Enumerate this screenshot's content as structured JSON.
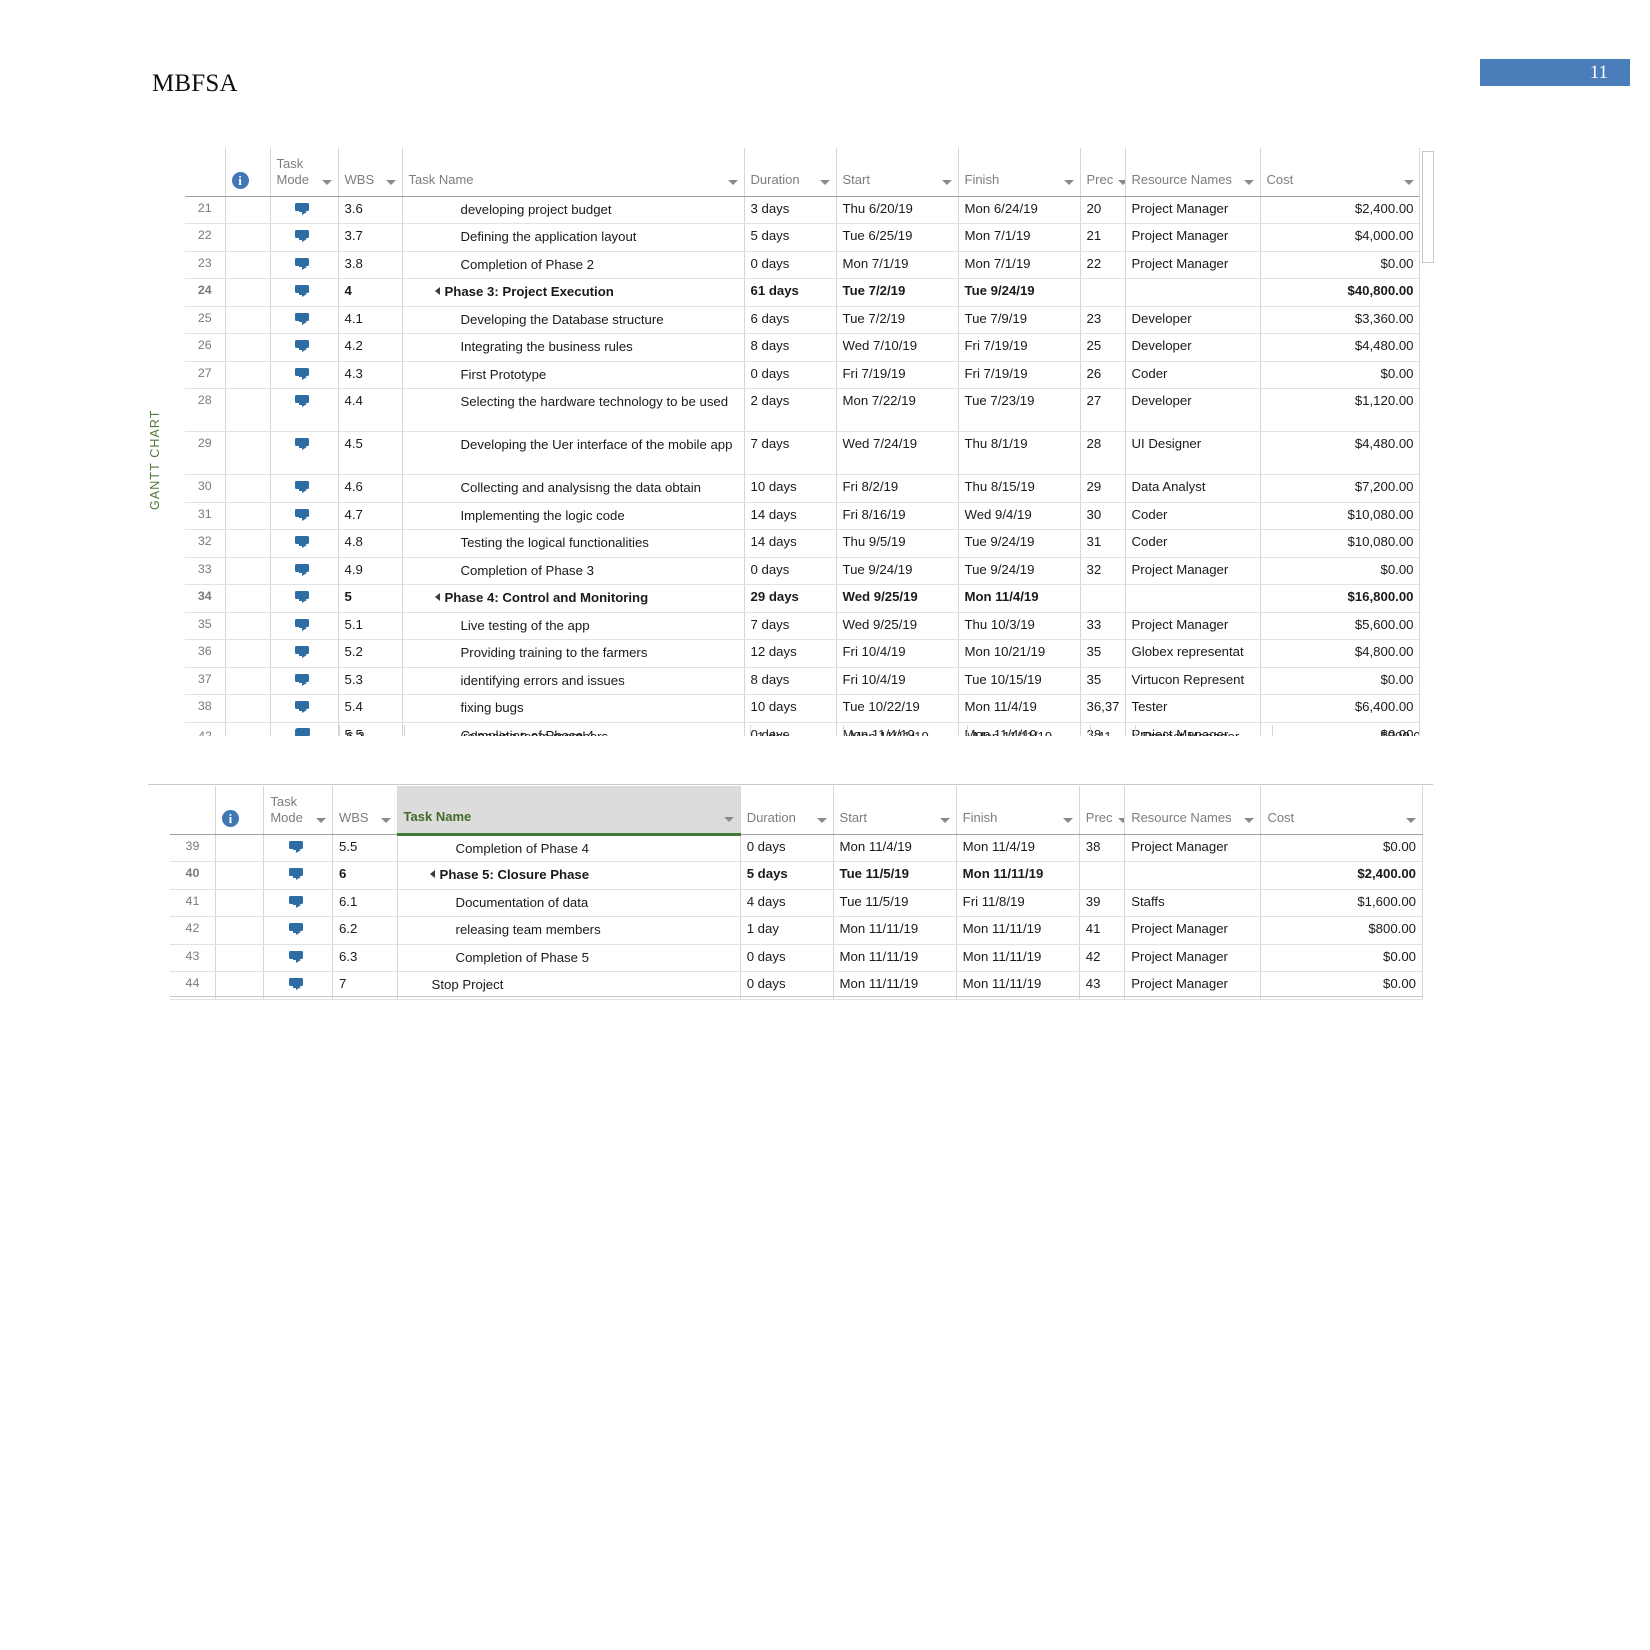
{
  "document": {
    "title": "MBFSA",
    "page_number": "11",
    "side_tab_label": "GANTT CHART"
  },
  "columns": {
    "id": "",
    "info": "i",
    "task_mode_l1": "Task",
    "task_mode_l2": "Mode",
    "wbs": "WBS",
    "task_name": "Task Name",
    "duration": "Duration",
    "start": "Start",
    "finish": "Finish",
    "predecessors": "Prec",
    "resource_names": "Resource Names",
    "cost": "Cost"
  },
  "top_grid": {
    "selected_row_id": "41",
    "rows": [
      {
        "id": "21",
        "wbs": "3.6",
        "name": "developing project budget",
        "indent": 2,
        "summary": false,
        "duration": "3 days",
        "start": "Thu 6/20/19",
        "finish": "Mon 6/24/19",
        "pred": "20",
        "res": "Project Manager",
        "cost": "$2,400.00",
        "tall": false
      },
      {
        "id": "22",
        "wbs": "3.7",
        "name": "Defining the application layout",
        "indent": 2,
        "summary": false,
        "duration": "5 days",
        "start": "Tue 6/25/19",
        "finish": "Mon 7/1/19",
        "pred": "21",
        "res": "Project Manager",
        "cost": "$4,000.00",
        "tall": false
      },
      {
        "id": "23",
        "wbs": "3.8",
        "name": "Completion of Phase 2",
        "indent": 2,
        "summary": false,
        "duration": "0 days",
        "start": "Mon 7/1/19",
        "finish": "Mon 7/1/19",
        "pred": "22",
        "res": "Project Manager",
        "cost": "$0.00",
        "tall": false
      },
      {
        "id": "24",
        "wbs": "4",
        "name": "Phase 3: Project Execution",
        "indent": 1,
        "summary": true,
        "duration": "61 days",
        "start": "Tue 7/2/19",
        "finish": "Tue 9/24/19",
        "pred": "",
        "res": "",
        "cost": "$40,800.00",
        "tall": false
      },
      {
        "id": "25",
        "wbs": "4.1",
        "name": "Developing the Database structure",
        "indent": 2,
        "summary": false,
        "duration": "6 days",
        "start": "Tue 7/2/19",
        "finish": "Tue 7/9/19",
        "pred": "23",
        "res": "Developer",
        "cost": "$3,360.00",
        "tall": false
      },
      {
        "id": "26",
        "wbs": "4.2",
        "name": "Integrating the business rules",
        "indent": 2,
        "summary": false,
        "duration": "8 days",
        "start": "Wed 7/10/19",
        "finish": "Fri 7/19/19",
        "pred": "25",
        "res": "Developer",
        "cost": "$4,480.00",
        "tall": false
      },
      {
        "id": "27",
        "wbs": "4.3",
        "name": "First Prototype",
        "indent": 2,
        "summary": false,
        "duration": "0 days",
        "start": "Fri 7/19/19",
        "finish": "Fri 7/19/19",
        "pred": "26",
        "res": "Coder",
        "cost": "$0.00",
        "tall": false
      },
      {
        "id": "28",
        "wbs": "4.4",
        "name": "Selecting the hardware technology to be used",
        "indent": 2,
        "summary": false,
        "duration": "2 days",
        "start": "Mon 7/22/19",
        "finish": "Tue 7/23/19",
        "pred": "27",
        "res": "Developer",
        "cost": "$1,120.00",
        "tall": true
      },
      {
        "id": "29",
        "wbs": "4.5",
        "name": "Developing the Uer interface of the mobile app",
        "indent": 2,
        "summary": false,
        "duration": "7 days",
        "start": "Wed 7/24/19",
        "finish": "Thu 8/1/19",
        "pred": "28",
        "res": "UI Designer",
        "cost": "$4,480.00",
        "tall": true
      },
      {
        "id": "30",
        "wbs": "4.6",
        "name": "Collecting and analysisng the data obtain",
        "indent": 2,
        "summary": false,
        "duration": "10 days",
        "start": "Fri 8/2/19",
        "finish": "Thu 8/15/19",
        "pred": "29",
        "res": "Data Analyst",
        "cost": "$7,200.00",
        "tall": false
      },
      {
        "id": "31",
        "wbs": "4.7",
        "name": "Implementing the logic code",
        "indent": 2,
        "summary": false,
        "duration": "14 days",
        "start": "Fri 8/16/19",
        "finish": "Wed 9/4/19",
        "pred": "30",
        "res": "Coder",
        "cost": "$10,080.00",
        "tall": false
      },
      {
        "id": "32",
        "wbs": "4.8",
        "name": "Testing the logical functionalities",
        "indent": 2,
        "summary": false,
        "duration": "14 days",
        "start": "Thu 9/5/19",
        "finish": "Tue 9/24/19",
        "pred": "31",
        "res": "Coder",
        "cost": "$10,080.00",
        "tall": false
      },
      {
        "id": "33",
        "wbs": "4.9",
        "name": "Completion of Phase 3",
        "indent": 2,
        "summary": false,
        "duration": "0 days",
        "start": "Tue 9/24/19",
        "finish": "Tue 9/24/19",
        "pred": "32",
        "res": "Project Manager",
        "cost": "$0.00",
        "tall": false
      },
      {
        "id": "34",
        "wbs": "5",
        "name": "Phase 4: Control and Monitoring",
        "indent": 1,
        "summary": true,
        "duration": "29 days",
        "start": "Wed 9/25/19",
        "finish": "Mon 11/4/19",
        "pred": "",
        "res": "",
        "cost": "$16,800.00",
        "tall": false
      },
      {
        "id": "35",
        "wbs": "5.1",
        "name": "Live testing of the app",
        "indent": 2,
        "summary": false,
        "duration": "7 days",
        "start": "Wed 9/25/19",
        "finish": "Thu 10/3/19",
        "pred": "33",
        "res": "Project Manager",
        "cost": "$5,600.00",
        "tall": false
      },
      {
        "id": "36",
        "wbs": "5.2",
        "name": "Providing training to the farmers",
        "indent": 2,
        "summary": false,
        "duration": "12 days",
        "start": "Fri 10/4/19",
        "finish": "Mon 10/21/19",
        "pred": "35",
        "res": "Globex representat",
        "cost": "$4,800.00",
        "tall": false
      },
      {
        "id": "37",
        "wbs": "5.3",
        "name": "identifying errors and issues",
        "indent": 2,
        "summary": false,
        "duration": "8 days",
        "start": "Fri 10/4/19",
        "finish": "Tue 10/15/19",
        "pred": "35",
        "res": "Virtucon Represent",
        "cost": "$0.00",
        "tall": false
      },
      {
        "id": "38",
        "wbs": "5.4",
        "name": "fixing bugs",
        "indent": 2,
        "summary": false,
        "duration": "10 days",
        "start": "Tue 10/22/19",
        "finish": "Mon 11/4/19",
        "pred": "36,37",
        "res": "Tester",
        "cost": "$6,400.00",
        "tall": false
      },
      {
        "id": "39",
        "wbs": "5.5",
        "name": "Completion of Phase 4",
        "indent": 2,
        "summary": false,
        "duration": "0 days",
        "start": "Mon 11/4/19",
        "finish": "Mon 11/4/19",
        "pred": "38",
        "res": "Project Manager",
        "cost": "$0.00",
        "tall": false
      },
      {
        "id": "40",
        "wbs": "6",
        "name": "Phase 5: Closure Phase",
        "indent": 1,
        "summary": true,
        "duration": "5 days",
        "start": "Tue 11/5/19",
        "finish": "Mon 11/11/19",
        "pred": "",
        "res": "",
        "cost": "$2,400.00",
        "tall": false
      },
      {
        "id": "41",
        "wbs": "6.1",
        "name": "Documentation of data",
        "indent": 2,
        "summary": false,
        "duration": "4 days",
        "start": "Tue 11/5/19",
        "finish": "Fri 11/8/19",
        "pred": "39",
        "res": "Staffs",
        "cost": "$1,600.00",
        "tall": false
      }
    ],
    "clipped_row": {
      "id": "42",
      "wbs": "6.2",
      "name": "releasing team members",
      "duration": "1 day",
      "start": "Mon 11/11/19",
      "finish": "Mon 11/11/19",
      "pred": "41",
      "res": "Project Manager",
      "cost": "$800.00"
    }
  },
  "bottom_grid": {
    "active_column": "Task Name",
    "rows": [
      {
        "id": "39",
        "wbs": "5.5",
        "name": "Completion of Phase 4",
        "indent": 2,
        "summary": false,
        "duration": "0 days",
        "start": "Mon 11/4/19",
        "finish": "Mon 11/4/19",
        "pred": "38",
        "res": "Project Manager",
        "cost": "$0.00",
        "tall": false
      },
      {
        "id": "40",
        "wbs": "6",
        "name": "Phase 5: Closure Phase",
        "indent": 1,
        "summary": true,
        "duration": "5 days",
        "start": "Tue 11/5/19",
        "finish": "Mon 11/11/19",
        "pred": "",
        "res": "",
        "cost": "$2,400.00",
        "tall": false
      },
      {
        "id": "41",
        "wbs": "6.1",
        "name": "Documentation of data",
        "indent": 2,
        "summary": false,
        "duration": "4 days",
        "start": "Tue 11/5/19",
        "finish": "Fri 11/8/19",
        "pred": "39",
        "res": "Staffs",
        "cost": "$1,600.00",
        "tall": false
      },
      {
        "id": "42",
        "wbs": "6.2",
        "name": "releasing team members",
        "indent": 2,
        "summary": false,
        "duration": "1 day",
        "start": "Mon 11/11/19",
        "finish": "Mon 11/11/19",
        "pred": "41",
        "res": "Project Manager",
        "cost": "$800.00",
        "tall": false
      },
      {
        "id": "43",
        "wbs": "6.3",
        "name": "Completion of Phase 5",
        "indent": 2,
        "summary": false,
        "duration": "0 days",
        "start": "Mon 11/11/19",
        "finish": "Mon 11/11/19",
        "pred": "42",
        "res": "Project Manager",
        "cost": "$0.00",
        "tall": false
      },
      {
        "id": "44",
        "wbs": "7",
        "name": "Stop Project",
        "indent": 0,
        "summary": false,
        "duration": "0 days",
        "start": "Mon 11/11/19",
        "finish": "Mon 11/11/19",
        "pred": "43",
        "res": "Project Manager",
        "cost": "$0.00",
        "tall": false
      }
    ]
  },
  "colors": {
    "page_badge": "#4a7ebb",
    "task_mode_icon": "#2e6da4",
    "info_icon": "#3f78b5",
    "selection_green": "#2f6f2f",
    "active_header_text": "#3f6b2b"
  }
}
